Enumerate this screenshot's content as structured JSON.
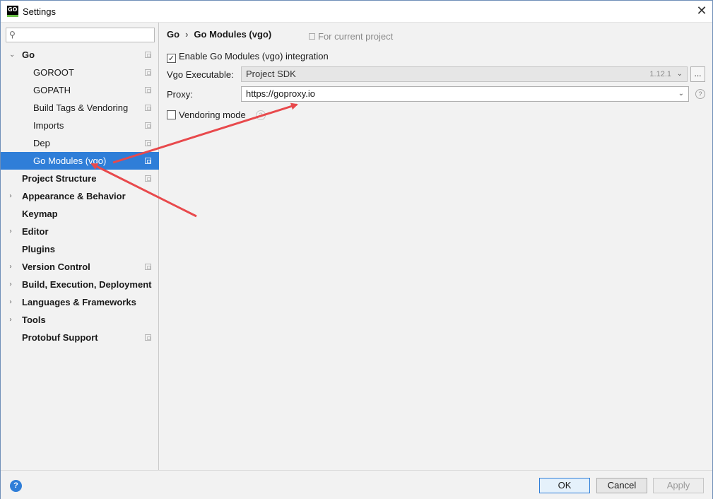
{
  "window": {
    "title": "Settings",
    "app_icon_text": "GO",
    "close_glyph": "✕"
  },
  "sidebar": {
    "search_placeholder": "",
    "items": [
      {
        "label": "Go",
        "level": 0,
        "expandable": true,
        "expanded": true,
        "bold": true,
        "copy_icon": true
      },
      {
        "label": "GOROOT",
        "level": 1,
        "copy_icon": true
      },
      {
        "label": "GOPATH",
        "level": 1,
        "copy_icon": true
      },
      {
        "label": "Build Tags & Vendoring",
        "level": 1,
        "copy_icon": true
      },
      {
        "label": "Imports",
        "level": 1,
        "copy_icon": true
      },
      {
        "label": "Dep",
        "level": 1,
        "copy_icon": true
      },
      {
        "label": "Go Modules (vgo)",
        "level": 1,
        "copy_icon": true,
        "selected": true
      },
      {
        "label": "Project Structure",
        "level": 0,
        "bold": true,
        "copy_icon": true
      },
      {
        "label": "Appearance & Behavior",
        "level": 0,
        "expandable": true,
        "bold": true
      },
      {
        "label": "Keymap",
        "level": 0,
        "bold": true
      },
      {
        "label": "Editor",
        "level": 0,
        "expandable": true,
        "bold": true
      },
      {
        "label": "Plugins",
        "level": 0,
        "bold": true
      },
      {
        "label": "Version Control",
        "level": 0,
        "expandable": true,
        "bold": true,
        "copy_icon": true
      },
      {
        "label": "Build, Execution, Deployment",
        "level": 0,
        "expandable": true,
        "bold": true
      },
      {
        "label": "Languages & Frameworks",
        "level": 0,
        "expandable": true,
        "bold": true
      },
      {
        "label": "Tools",
        "level": 0,
        "expandable": true,
        "bold": true
      },
      {
        "label": "Protobuf Support",
        "level": 0,
        "bold": true,
        "copy_icon": true
      }
    ]
  },
  "main": {
    "breadcrumb_root": "Go",
    "breadcrumb_sep": "›",
    "breadcrumb_page": "Go Modules (vgo)",
    "scope_label": "For current project",
    "enable_label": "Enable Go Modules (vgo) integration",
    "enable_checked": true,
    "vgo_label": "Vgo Executable:",
    "vgo_value": "Project SDK",
    "vgo_version": "1.12.1",
    "dots_label": "...",
    "proxy_label": "Proxy:",
    "proxy_value": "https://goproxy.io",
    "vendoring_label": "Vendoring mode",
    "vendoring_checked": false,
    "help_glyph": "?"
  },
  "footer": {
    "help_glyph": "?",
    "ok_label": "OK",
    "cancel_label": "Cancel",
    "apply_label": "Apply"
  },
  "colors": {
    "selection": "#2f7ed8",
    "annotation_arrow": "#e8494c"
  },
  "icons": [
    "search-icon",
    "close-icon",
    "copy-icon",
    "chevron-down-icon",
    "help-icon",
    "checkbox-checked-icon"
  ]
}
